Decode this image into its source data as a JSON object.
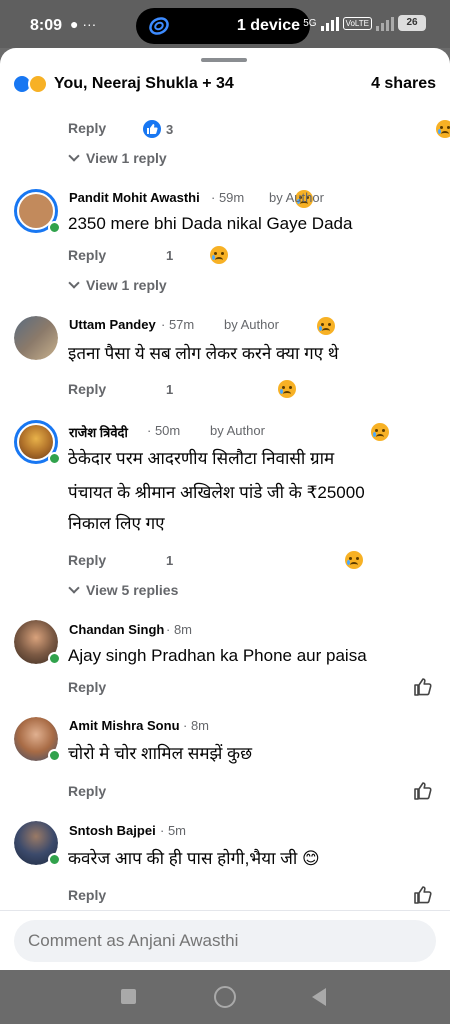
{
  "status_bar": {
    "time": "8:09",
    "left_icons": "● ···",
    "device_label": "1 device",
    "network": "5G",
    "volte": "VoLTE",
    "battery": "26"
  },
  "header": {
    "reactors": "You, Neeraj Shukla + 34",
    "shares": "4 shares"
  },
  "thread_top": {
    "reply_label": "Reply",
    "like_count": "3",
    "view_replies": "View 1 reply"
  },
  "comments": [
    {
      "author": "Pandit Mohit Awasthi",
      "time": "· 59m",
      "by_author": "by Author",
      "text": "2350 mere bhi Dada nikal Gaye Dada",
      "reply_label": "Reply",
      "reaction_count": "1",
      "view_replies": "View 1 reply",
      "avatar_color": "#c28a5c"
    },
    {
      "author": "Uttam Pandey",
      "time": "· 57m",
      "by_author": "by Author",
      "text": "इतना पैसा ये सब लोग लेकर करने क्या गए थे",
      "reply_label": "Reply",
      "reaction_count": "1",
      "avatar_color": "#8b7a6a"
    },
    {
      "author": "राजेश त्रिवेदी",
      "time": "· 50m",
      "by_author": "by Author",
      "text_lines": [
        "ठेकेदार परम आदरणीय सिलौटा निवासी ग्राम",
        "पंचायत के श्रीमान अखिलेश पांडे जी के ₹25000",
        "निकाल लिए गए"
      ],
      "reply_label": "Reply",
      "reaction_count": "1",
      "view_replies": "View 5 replies",
      "avatar_color": "#b3742b"
    },
    {
      "author": "Chandan Singh",
      "time": "· 8m",
      "text": "Ajay singh Pradhan ka Phone aur paisa",
      "reply_label": "Reply",
      "avatar_color": "#7c5a44"
    },
    {
      "author": "Amit Mishra Sonu",
      "time": "· 8m",
      "text": "चोरो मे चोर शामिल समझें कुछ",
      "reply_label": "Reply",
      "avatar_color": "#a86b45"
    },
    {
      "author": "Sntosh Bajpei",
      "time": "· 5m",
      "text": "कवरेज आप की ही पास होगी,भैया जी 😊",
      "reply_label": "Reply",
      "avatar_color": "#3c4a6b"
    }
  ],
  "composer": {
    "placeholder": "Comment as Anjani Awasthi"
  },
  "colors": {
    "accent": "#1877f2",
    "online": "#31a24c",
    "muted": "#65676b"
  }
}
